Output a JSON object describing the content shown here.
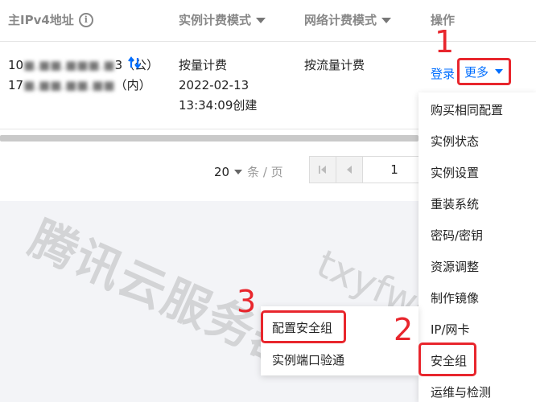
{
  "header": {
    "ip_col": "主IPv4地址",
    "instance_billing_col": "实例计费模式",
    "network_billing_col": "网络计费模式",
    "ops_col": "操作"
  },
  "row": {
    "public_ip_prefix": "10",
    "public_ip_masked": "■.■■.■■■.■",
    "public_ip_suffix": "3（公）",
    "private_ip_prefix": "17",
    "private_ip_masked": "■.■■.■■.■■",
    "private_ip_suffix": "（内）",
    "instance_billing": "按量计费",
    "created_date": "2022-02-13",
    "created_time": "13:34:09创建",
    "network_billing": "按流量计费",
    "login_label": "登录",
    "more_label": "更多"
  },
  "pagination": {
    "page_size": "20",
    "unit": "条 / 页",
    "current_page": "1"
  },
  "more_menu": [
    "购买相同配置",
    "实例状态",
    "实例设置",
    "重装系统",
    "密码/密钥",
    "资源调整",
    "制作镜像",
    "IP/网卡",
    "安全组",
    "运维与检测"
  ],
  "security_submenu": [
    "配置安全组",
    "实例端口验通"
  ],
  "steps": [
    "1",
    "2",
    "3"
  ],
  "watermark": {
    "text": "腾讯云服务器",
    "url": "txyfwq.com"
  },
  "colors": {
    "link": "#006eff",
    "annotation_red": "#e8262d"
  },
  "icons": {
    "ip_info": "info-icon",
    "copy": "refresh-icon",
    "filter": "filter-icon",
    "more_caret": "caret-down-icon"
  }
}
